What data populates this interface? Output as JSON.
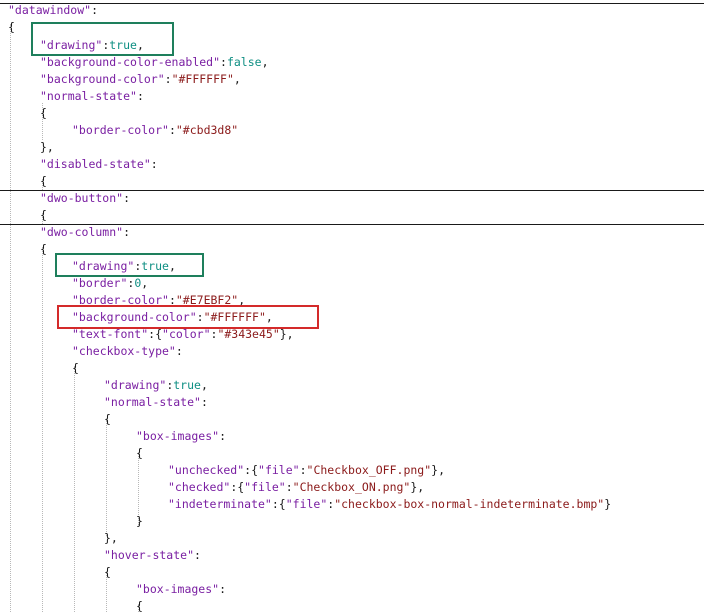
{
  "editor": {
    "lines": [
      {
        "level": 0,
        "tokens": [
          [
            "key",
            "\"datawindow\""
          ],
          [
            "pun",
            ":"
          ]
        ]
      },
      {
        "level": 0,
        "tokens": [
          [
            "pun",
            "{"
          ]
        ]
      },
      {
        "level": 1,
        "tokens": [
          [
            "key",
            "\"drawing\""
          ],
          [
            "pun",
            ":"
          ],
          [
            "bool",
            "true"
          ],
          [
            "pun",
            ","
          ]
        ]
      },
      {
        "level": 1,
        "tokens": [
          [
            "key",
            "\"background-color-enabled\""
          ],
          [
            "pun",
            ":"
          ],
          [
            "bool",
            "false"
          ],
          [
            "pun",
            ","
          ]
        ]
      },
      {
        "level": 1,
        "tokens": [
          [
            "key",
            "\"background-color\""
          ],
          [
            "pun",
            ":"
          ],
          [
            "str",
            "\"#FFFFFF\""
          ],
          [
            "pun",
            ","
          ]
        ]
      },
      {
        "level": 1,
        "tokens": [
          [
            "key",
            "\"normal-state\""
          ],
          [
            "pun",
            ":"
          ]
        ]
      },
      {
        "level": 1,
        "tokens": [
          [
            "pun",
            "{"
          ]
        ]
      },
      {
        "level": 2,
        "tokens": [
          [
            "key",
            "\"border-color\""
          ],
          [
            "pun",
            ":"
          ],
          [
            "str",
            "\"#cbd3d8\""
          ]
        ]
      },
      {
        "level": 1,
        "tokens": [
          [
            "pun",
            "},"
          ]
        ]
      },
      {
        "level": 1,
        "tokens": [
          [
            "key",
            "\"disabled-state\""
          ],
          [
            "pun",
            ":"
          ]
        ]
      },
      {
        "level": 1,
        "tokens": [
          [
            "pun",
            "{"
          ]
        ]
      },
      {
        "level": 1,
        "tokens": [
          [
            "key",
            "\"dwo-button\""
          ],
          [
            "pun",
            ":"
          ]
        ]
      },
      {
        "level": 1,
        "tokens": [
          [
            "pun",
            "{"
          ]
        ]
      },
      {
        "level": 1,
        "tokens": [
          [
            "key",
            "\"dwo-column\""
          ],
          [
            "pun",
            ":"
          ]
        ]
      },
      {
        "level": 1,
        "tokens": [
          [
            "pun",
            "{"
          ]
        ]
      },
      {
        "level": 2,
        "tokens": [
          [
            "key",
            "\"drawing\""
          ],
          [
            "pun",
            ":"
          ],
          [
            "bool",
            "true"
          ],
          [
            "pun",
            ","
          ]
        ]
      },
      {
        "level": 2,
        "tokens": [
          [
            "key",
            "\"border\""
          ],
          [
            "pun",
            ":"
          ],
          [
            "num",
            "0"
          ],
          [
            "pun",
            ","
          ]
        ]
      },
      {
        "level": 2,
        "tokens": [
          [
            "key",
            "\"border-color\""
          ],
          [
            "pun",
            ":"
          ],
          [
            "str",
            "\"#E7EBF2\""
          ],
          [
            "pun",
            ","
          ]
        ]
      },
      {
        "level": 2,
        "tokens": [
          [
            "key",
            "\"background-color\""
          ],
          [
            "pun",
            ":"
          ],
          [
            "str",
            "\"#FFFFFF\""
          ],
          [
            "pun",
            ","
          ]
        ]
      },
      {
        "level": 2,
        "tokens": [
          [
            "key",
            "\"text-font\""
          ],
          [
            "pun",
            ":{"
          ],
          [
            "key",
            "\"color\""
          ],
          [
            "pun",
            ":"
          ],
          [
            "str",
            "\"#343e45\""
          ],
          [
            "pun",
            "},"
          ]
        ]
      },
      {
        "level": 2,
        "tokens": [
          [
            "key",
            "\"checkbox-type\""
          ],
          [
            "pun",
            ":"
          ]
        ]
      },
      {
        "level": 2,
        "tokens": [
          [
            "pun",
            "{"
          ]
        ]
      },
      {
        "level": 3,
        "tokens": [
          [
            "key",
            "\"drawing\""
          ],
          [
            "pun",
            ":"
          ],
          [
            "bool",
            "true"
          ],
          [
            "pun",
            ","
          ]
        ]
      },
      {
        "level": 3,
        "tokens": [
          [
            "key",
            "\"normal-state\""
          ],
          [
            "pun",
            ":"
          ]
        ]
      },
      {
        "level": 3,
        "tokens": [
          [
            "pun",
            "{"
          ]
        ]
      },
      {
        "level": 4,
        "tokens": [
          [
            "key",
            "\"box-images\""
          ],
          [
            "pun",
            ":"
          ]
        ]
      },
      {
        "level": 4,
        "tokens": [
          [
            "pun",
            "{"
          ]
        ]
      },
      {
        "level": 5,
        "tokens": [
          [
            "key",
            "\"unchecked\""
          ],
          [
            "pun",
            ":{"
          ],
          [
            "key",
            "\"file\""
          ],
          [
            "pun",
            ":"
          ],
          [
            "str",
            "\"Checkbox_OFF.png\""
          ],
          [
            "pun",
            "},"
          ]
        ]
      },
      {
        "level": 5,
        "tokens": [
          [
            "key",
            "\"checked\""
          ],
          [
            "pun",
            ":{"
          ],
          [
            "key",
            "\"file\""
          ],
          [
            "pun",
            ":"
          ],
          [
            "str",
            "\"Checkbox_ON.png\""
          ],
          [
            "pun",
            "},"
          ]
        ]
      },
      {
        "level": 5,
        "tokens": [
          [
            "key",
            "\"indeterminate\""
          ],
          [
            "pun",
            ":{"
          ],
          [
            "key",
            "\"file\""
          ],
          [
            "pun",
            ":"
          ],
          [
            "str",
            "\"checkbox-box-normal-indeterminate.bmp\""
          ],
          [
            "pun",
            "}"
          ]
        ]
      },
      {
        "level": 4,
        "tokens": [
          [
            "pun",
            "}"
          ]
        ]
      },
      {
        "level": 3,
        "tokens": [
          [
            "pun",
            "},"
          ]
        ]
      },
      {
        "level": 3,
        "tokens": [
          [
            "key",
            "\"hover-state\""
          ],
          [
            "pun",
            ":"
          ]
        ]
      },
      {
        "level": 3,
        "tokens": [
          [
            "pun",
            "{"
          ]
        ]
      },
      {
        "level": 4,
        "tokens": [
          [
            "key",
            "\"box-images\""
          ],
          [
            "pun",
            ":"
          ]
        ]
      },
      {
        "level": 4,
        "tokens": [
          [
            "pun",
            "{"
          ]
        ]
      }
    ],
    "highlight_colors": {
      "green": "#1e7f5c",
      "red": "#d42a2a"
    },
    "token_colors": {
      "key": "#7a1fa2",
      "string": "#8b1a1a",
      "literal": "#0f8f83"
    }
  }
}
